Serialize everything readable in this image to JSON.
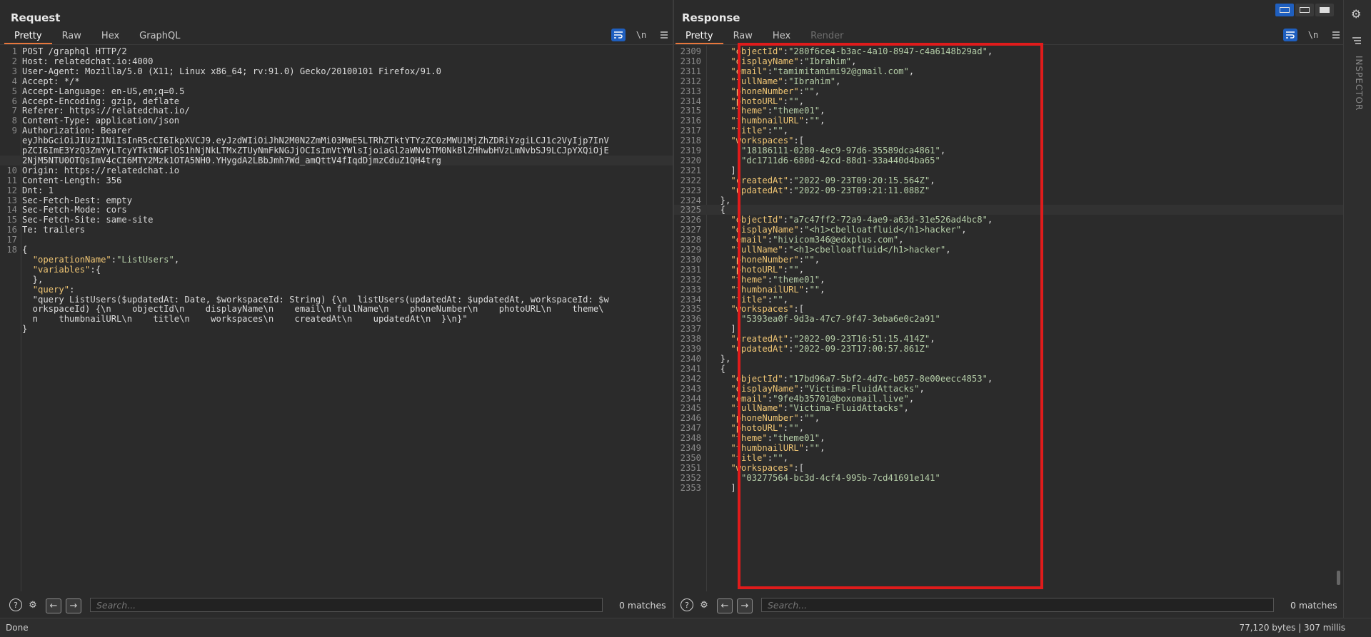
{
  "request": {
    "title": "Request",
    "tabs": [
      "Pretty",
      "Raw",
      "Hex",
      "GraphQL"
    ],
    "icon_labels": {
      "newline": "\\n"
    },
    "lines": [
      {
        "n": "1",
        "t": "POST /graphql HTTP/2"
      },
      {
        "n": "2",
        "t": "Host: relatedchat.io:4000"
      },
      {
        "n": "3",
        "t": "User-Agent: Mozilla/5.0 (X11; Linux x86_64; rv:91.0) Gecko/20100101 Firefox/91.0"
      },
      {
        "n": "4",
        "t": "Accept: */*"
      },
      {
        "n": "5",
        "t": "Accept-Language: en-US,en;q=0.5"
      },
      {
        "n": "6",
        "t": "Accept-Encoding: gzip, deflate"
      },
      {
        "n": "7",
        "t": "Referer: https://relatedchat.io/"
      },
      {
        "n": "8",
        "t": "Content-Type: application/json"
      },
      {
        "n": "9",
        "t": "Authorization: Bearer"
      },
      {
        "n": "",
        "t": "eyJhbGciOiJIUzI1NiIsInR5cCI6IkpXVCJ9.eyJzdWIiOiJhN2M0N2ZmMi03MmE5LTRhZTktYTYzZC0zMWU1MjZhZDRiYzgiLCJ1c2VyIjp7InV"
      },
      {
        "n": "",
        "t": "pZCI6ImE3YzQ3ZmYyLTcyYTktNGFlOS1hNjNkLTMxZTUyNmFkNGJjOCIsImVtYWlsIjoiaGl2aWNvbTM0NkBlZHhwbHVzLmNvbSJ9LCJpYXQiOjE"
      },
      {
        "n": "",
        "t": "2NjM5NTU0OTQsImV4cCI6MTY2Mzk1OTA5NH0.YHygdA2LBbJmh7Wd_amQttV4fIqdDjmzCduZ1QH4trg"
      },
      {
        "n": "10",
        "t": "Origin: https://relatedchat.io"
      },
      {
        "n": "11",
        "t": "Content-Length: 356"
      },
      {
        "n": "12",
        "t": "Dnt: 1"
      },
      {
        "n": "13",
        "t": "Sec-Fetch-Dest: empty"
      },
      {
        "n": "14",
        "t": "Sec-Fetch-Mode: cors"
      },
      {
        "n": "15",
        "t": "Sec-Fetch-Site: same-site"
      },
      {
        "n": "16",
        "t": "Te: trailers"
      },
      {
        "n": "17",
        "t": ""
      },
      {
        "n": "18",
        "t": "{"
      },
      {
        "n": "",
        "t": "  \"operationName\":\"ListUsers\","
      },
      {
        "n": "",
        "t": "  \"variables\":{"
      },
      {
        "n": "",
        "t": "  },"
      },
      {
        "n": "",
        "t": "  \"query\":"
      },
      {
        "n": "",
        "t": "  \"query ListUsers($updatedAt: Date, $workspaceId: String) {\\n  listUsers(updatedAt: $updatedAt, workspaceId: $w"
      },
      {
        "n": "",
        "t": "  orkspaceId) {\\n    objectId\\n    displayName\\n    email\\n fullName\\n    phoneNumber\\n    photoURL\\n    theme\\"
      },
      {
        "n": "",
        "t": "  n    thumbnailURL\\n    title\\n    workspaces\\n    createdAt\\n    updatedAt\\n  }\\n}\""
      },
      {
        "n": "",
        "t": "}"
      }
    ],
    "search_placeholder": "Search...",
    "matches": "0 matches"
  },
  "response": {
    "title": "Response",
    "tabs": [
      "Pretty",
      "Raw",
      "Hex",
      "Render"
    ],
    "icon_labels": {
      "newline": "\\n"
    },
    "lines": [
      {
        "n": "2309",
        "t": "    \"objectId\":\"280f6ce4-b3ac-4a10-8947-c4a6148b29ad\","
      },
      {
        "n": "2310",
        "t": "    \"displayName\":\"Ibrahim\","
      },
      {
        "n": "2311",
        "t": "    \"email\":\"tamimitamimi92@gmail.com\","
      },
      {
        "n": "2312",
        "t": "    \"fullName\":\"Ibrahim\","
      },
      {
        "n": "2313",
        "t": "    \"phoneNumber\":\"\","
      },
      {
        "n": "2314",
        "t": "    \"photoURL\":\"\","
      },
      {
        "n": "2315",
        "t": "    \"theme\":\"theme01\","
      },
      {
        "n": "2316",
        "t": "    \"thumbnailURL\":\"\","
      },
      {
        "n": "2317",
        "t": "    \"title\":\"\","
      },
      {
        "n": "2318",
        "t": "    \"workspaces\":["
      },
      {
        "n": "2319",
        "t": "      \"18186111-0280-4ec9-97d6-35589dca4861\","
      },
      {
        "n": "2320",
        "t": "      \"dc1711d6-680d-42cd-88d1-33a440d4ba65\""
      },
      {
        "n": "2321",
        "t": "    ],"
      },
      {
        "n": "2322",
        "t": "    \"createdAt\":\"2022-09-23T09:20:15.564Z\","
      },
      {
        "n": "2323",
        "t": "    \"updatedAt\":\"2022-09-23T09:21:11.088Z\""
      },
      {
        "n": "2324",
        "t": "  },"
      },
      {
        "n": "2325",
        "t": "  {"
      },
      {
        "n": "2326",
        "t": "    \"objectId\":\"a7c47ff2-72a9-4ae9-a63d-31e526ad4bc8\","
      },
      {
        "n": "2327",
        "t": "    \"displayName\":\"<h1>cbelloatfluid</h1>hacker\","
      },
      {
        "n": "2328",
        "t": "    \"email\":\"hivicom346@edxplus.com\","
      },
      {
        "n": "2329",
        "t": "    \"fullName\":\"<h1>cbelloatfluid</h1>hacker\","
      },
      {
        "n": "2330",
        "t": "    \"phoneNumber\":\"\","
      },
      {
        "n": "2331",
        "t": "    \"photoURL\":\"\","
      },
      {
        "n": "2332",
        "t": "    \"theme\":\"theme01\","
      },
      {
        "n": "2333",
        "t": "    \"thumbnailURL\":\"\","
      },
      {
        "n": "2334",
        "t": "    \"title\":\"\","
      },
      {
        "n": "2335",
        "t": "    \"workspaces\":["
      },
      {
        "n": "2336",
        "t": "      \"5393ea0f-9d3a-47c7-9f47-3eba6e0c2a91\""
      },
      {
        "n": "2337",
        "t": "    ],"
      },
      {
        "n": "2338",
        "t": "    \"createdAt\":\"2022-09-23T16:51:15.414Z\","
      },
      {
        "n": "2339",
        "t": "    \"updatedAt\":\"2022-09-23T17:00:57.861Z\""
      },
      {
        "n": "2340",
        "t": "  },"
      },
      {
        "n": "2341",
        "t": "  {"
      },
      {
        "n": "2342",
        "t": "    \"objectId\":\"17bd96a7-5bf2-4d7c-b057-8e00eecc4853\","
      },
      {
        "n": "2343",
        "t": "    \"displayName\":\"Victima-FluidAttacks\","
      },
      {
        "n": "2344",
        "t": "    \"email\":\"9fe4b35701@boxomail.live\","
      },
      {
        "n": "2345",
        "t": "    \"fullName\":\"Victima-FluidAttacks\","
      },
      {
        "n": "2346",
        "t": "    \"phoneNumber\":\"\","
      },
      {
        "n": "2347",
        "t": "    \"photoURL\":\"\","
      },
      {
        "n": "2348",
        "t": "    \"theme\":\"theme01\","
      },
      {
        "n": "2349",
        "t": "    \"thumbnailURL\":\"\","
      },
      {
        "n": "2350",
        "t": "    \"title\":\"\","
      },
      {
        "n": "2351",
        "t": "    \"workspaces\":["
      },
      {
        "n": "2352",
        "t": "      \"03277564-bc3d-4cf4-995b-7cd41691e141\""
      },
      {
        "n": "2353",
        "t": "    ],"
      }
    ],
    "search_placeholder": "Search...",
    "matches": "0 matches"
  },
  "inspector_label": "INSPECTOR",
  "status": {
    "left": "Done",
    "right": "77,120 bytes | 307 millis"
  },
  "colors": {
    "background": "#2b2b2b",
    "accent_tab": "#e8773c",
    "highlight_box": "#e01b1b",
    "json_key": "#f0c674",
    "json_string": "#b5cea8",
    "toggle_on": "#1f5fbf"
  }
}
